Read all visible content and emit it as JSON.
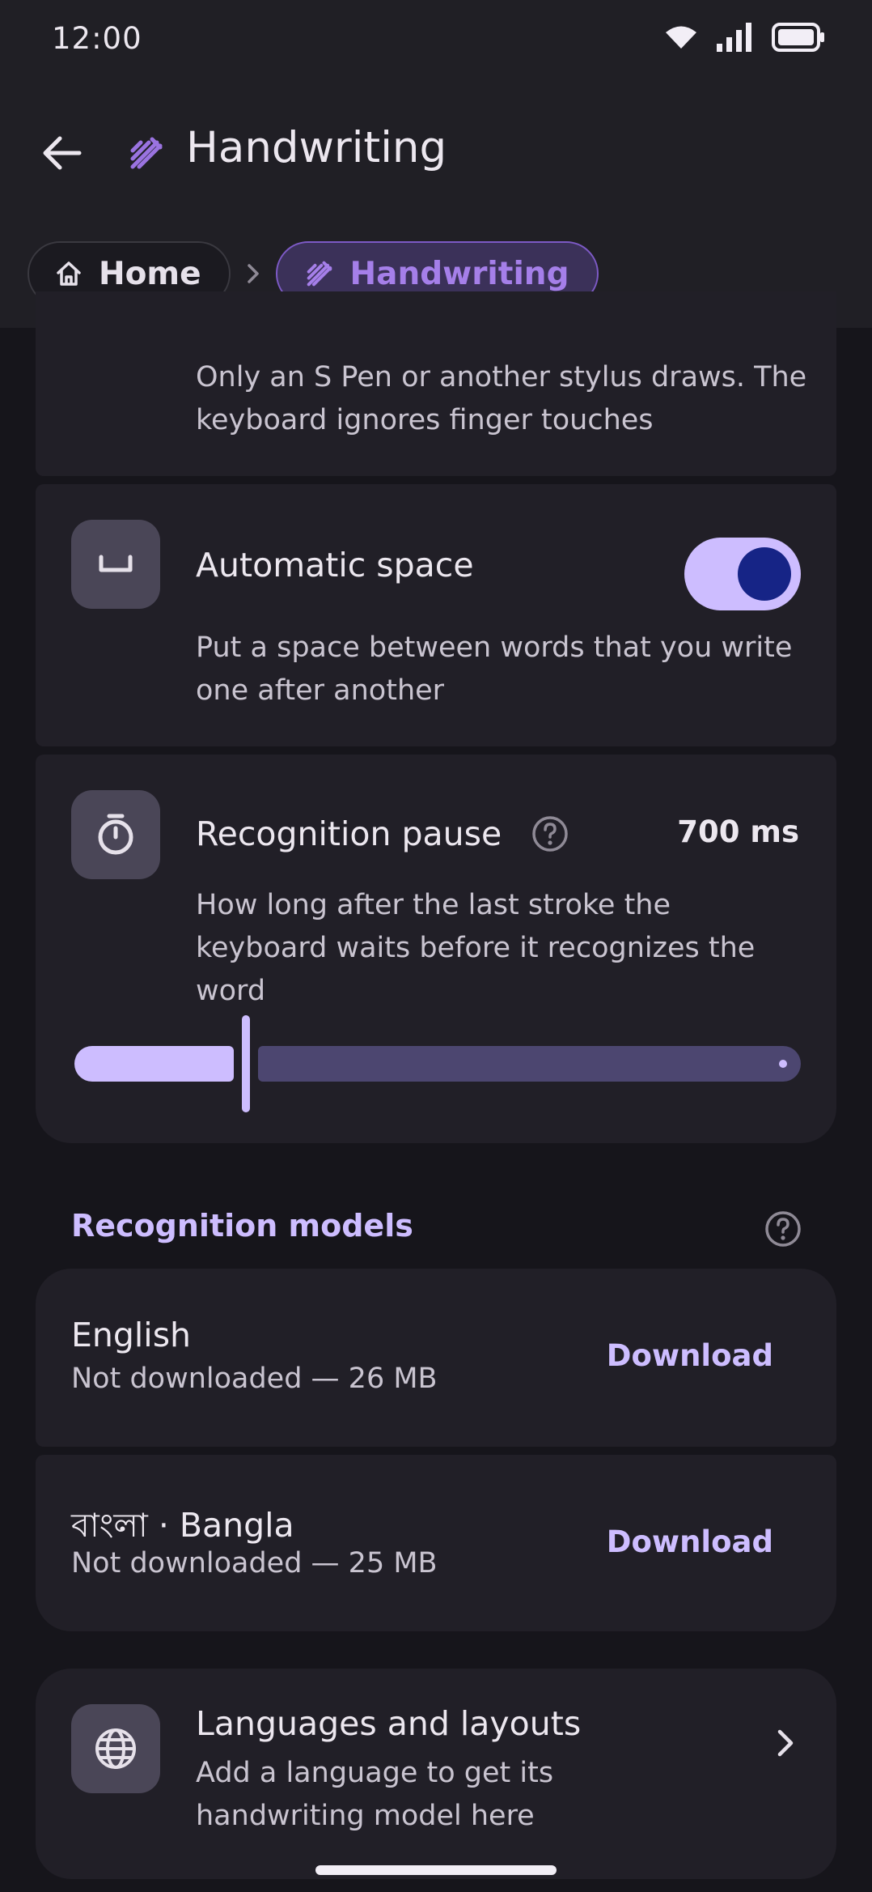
{
  "status_bar": {
    "time": "12:00"
  },
  "app_bar": {
    "title": "Handwriting"
  },
  "breadcrumb": {
    "home_label": "Home",
    "current_label": "Handwriting"
  },
  "settings": {
    "stylus_only": {
      "description": "Only an S Pen or another stylus draws. The keyboard ignores finger touches"
    },
    "automatic_space": {
      "title": "Automatic space",
      "description": "Put a space between words that you write one after another",
      "enabled": true
    },
    "recognition_pause": {
      "title": "Recognition pause",
      "value": "700 ms",
      "description": "How long after the last stroke the keyboard waits before it recognizes the word",
      "slider_fraction": 0.23
    }
  },
  "models_section": {
    "title": "Recognition models",
    "models": [
      {
        "name": "English",
        "status": "Not downloaded — 26 MB",
        "action": "Download"
      },
      {
        "name": "বাংলা · Bangla",
        "status": "Not downloaded — 25 MB",
        "action": "Download"
      }
    ]
  },
  "languages_link": {
    "title": "Languages and layouts",
    "description": "Add a language to get its handwriting model here"
  },
  "colors": {
    "accent": "#cdbdff",
    "accent_dark": "#162486",
    "breadcrumb_active": "#a57fe9",
    "surface": "#211f27",
    "background": "#16151b"
  }
}
